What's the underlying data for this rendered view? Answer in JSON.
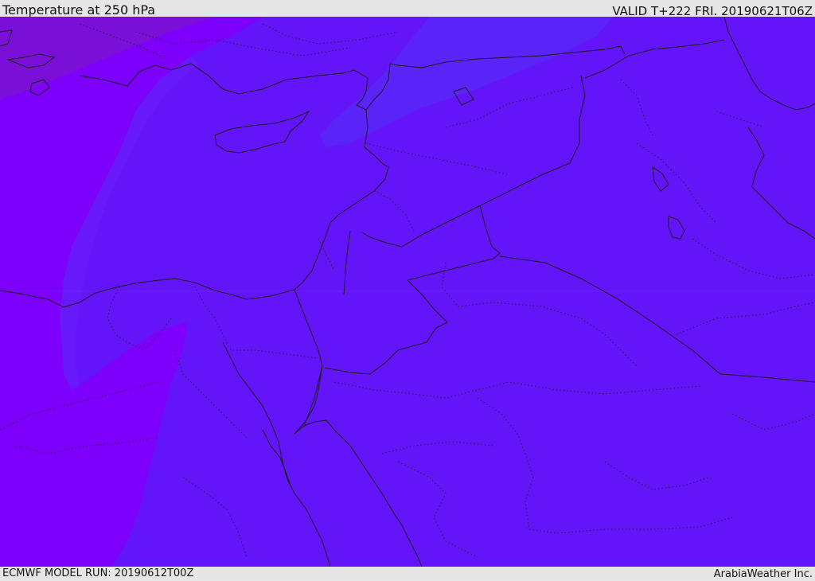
{
  "header": {
    "title": "Temperature at 250 hPa",
    "valid": "VALID T+222 FRI. 20190621T06Z"
  },
  "footer": {
    "model_run": "ECMWF MODEL RUN: 20190612T00Z",
    "credit": "ArabiaWeather Inc."
  },
  "colors": {
    "field_main": "#6414f8",
    "field_warm_west": "#7c00fc",
    "field_cold_north": "#5a24f8",
    "field_nw_corner": "#7a10d8",
    "boundary_line": "#1a1a1a"
  }
}
